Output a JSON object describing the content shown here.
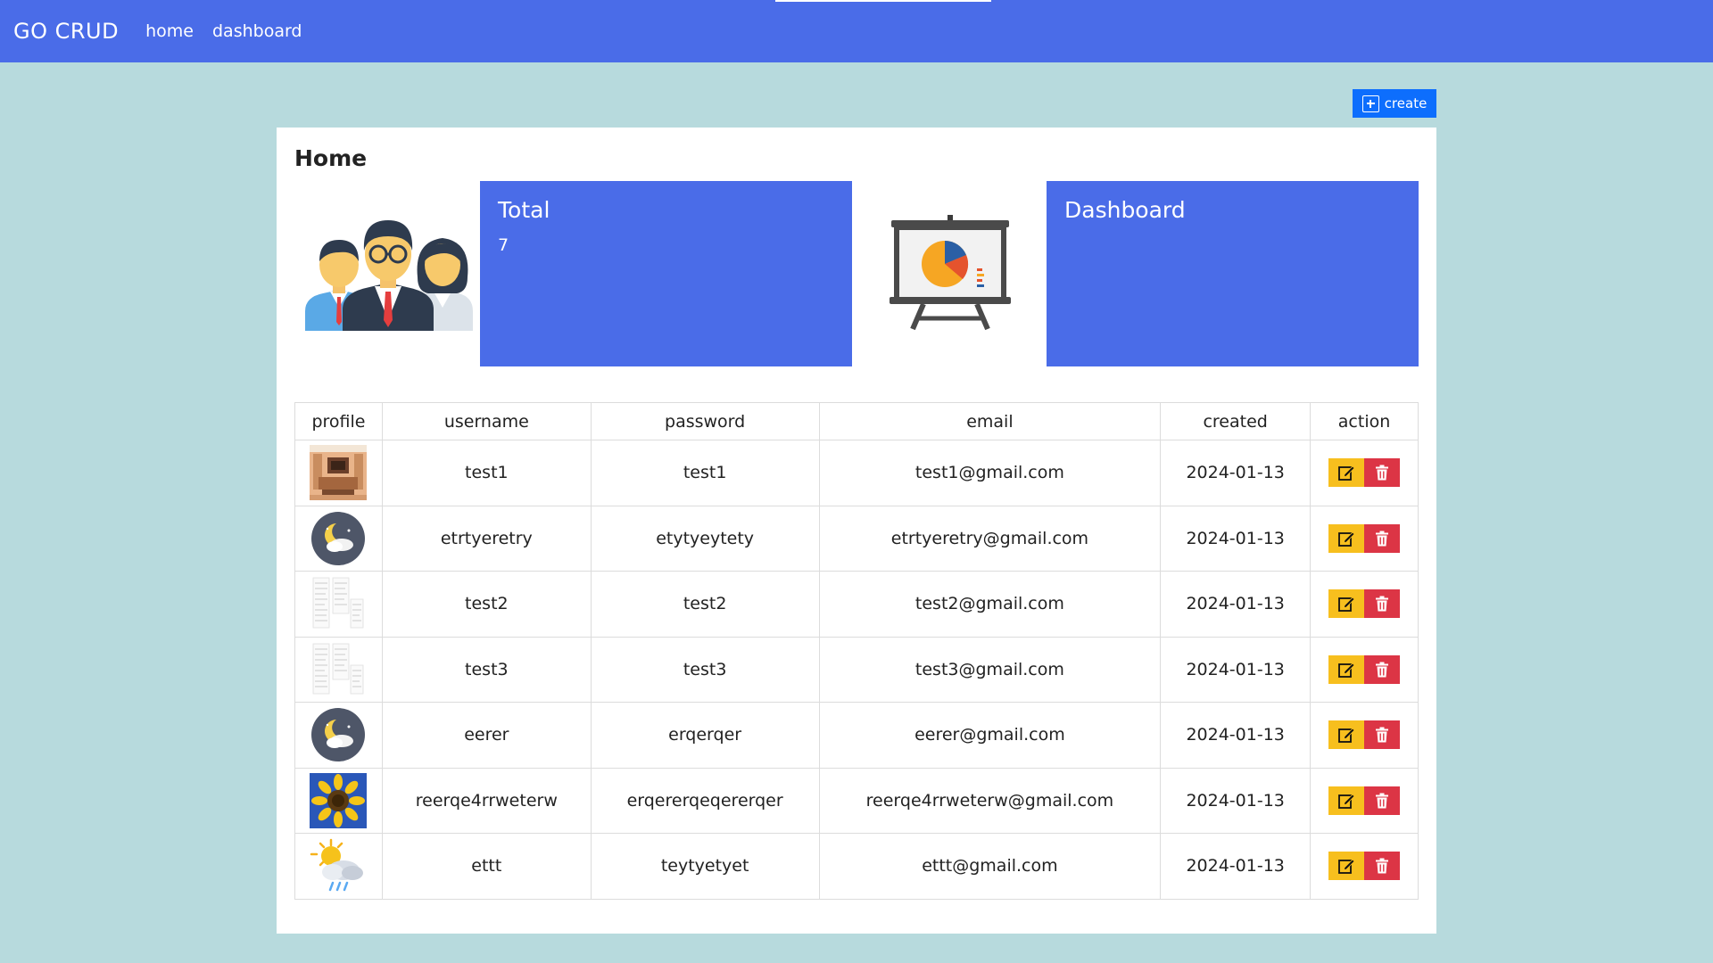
{
  "nav": {
    "brand": "GO CRUD",
    "links": [
      "home",
      "dashboard"
    ]
  },
  "toolbar": {
    "create_label": "create"
  },
  "page": {
    "title": "Home"
  },
  "stats": {
    "total_label": "Total",
    "total_value": "7",
    "dashboard_label": "Dashboard"
  },
  "table": {
    "headers": [
      "profile",
      "username",
      "password",
      "email",
      "created",
      "action"
    ],
    "rows": [
      {
        "profile": "room-photo",
        "username": "test1",
        "password": "test1",
        "email": "test1@gmail.com",
        "created": "2024-01-13"
      },
      {
        "profile": "night-cloud-icon",
        "username": "etrtyeretry",
        "password": "etytyeytety",
        "email": "etrtyeretry@gmail.com",
        "created": "2024-01-13"
      },
      {
        "profile": "document-thumbnail",
        "username": "test2",
        "password": "test2",
        "email": "test2@gmail.com",
        "created": "2024-01-13"
      },
      {
        "profile": "document-thumbnail",
        "username": "test3",
        "password": "test3",
        "email": "test3@gmail.com",
        "created": "2024-01-13"
      },
      {
        "profile": "night-cloud-icon",
        "username": "eerer",
        "password": "erqerqer",
        "email": "eerer@gmail.com",
        "created": "2024-01-13"
      },
      {
        "profile": "sunflower-photo",
        "username": "reerqe4rrweterw",
        "password": "erqererqeqererqer",
        "email": "reerqe4rrweterw@gmail.com",
        "created": "2024-01-13"
      },
      {
        "profile": "sun-rain-cloud-icon",
        "username": "ettt",
        "password": "teytyetyet",
        "email": "ettt@gmail.com",
        "created": "2024-01-13"
      }
    ]
  },
  "colors": {
    "navbar": "#4a6ce8",
    "background": "#b7dadd",
    "create_button": "#0d6efd",
    "edit_button": "#f7bf1e",
    "delete_button": "#dc3545"
  }
}
